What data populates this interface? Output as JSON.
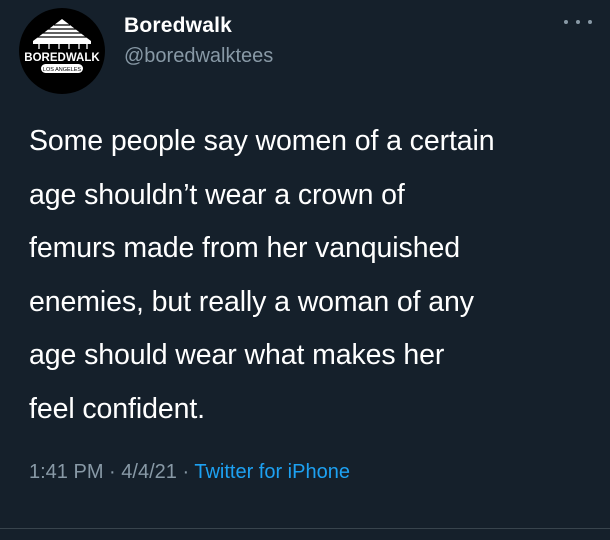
{
  "tweet": {
    "author": {
      "display_name": "Boredwalk",
      "handle": "@boredwalktees",
      "avatar": {
        "icon": "boredwalk-logo-icon",
        "logo_text": "BOREDWALK",
        "logo_subtext": "LOS ANGELES"
      }
    },
    "more_icon": "more-horizontal-icon",
    "text": "Some people say women of a certain\nage shouldn’t wear a crown of\nfemurs made from her vanquished\nenemies, but really a woman of any\nage should wear what makes her\nfeel confident.",
    "time": "1:41 PM",
    "date": "4/4/21",
    "separator": "·",
    "source": "Twitter for iPhone"
  },
  "colors": {
    "background": "#15202b",
    "primary_text": "#ffffff",
    "secondary_text": "#8899a6",
    "link": "#1da1f2"
  }
}
